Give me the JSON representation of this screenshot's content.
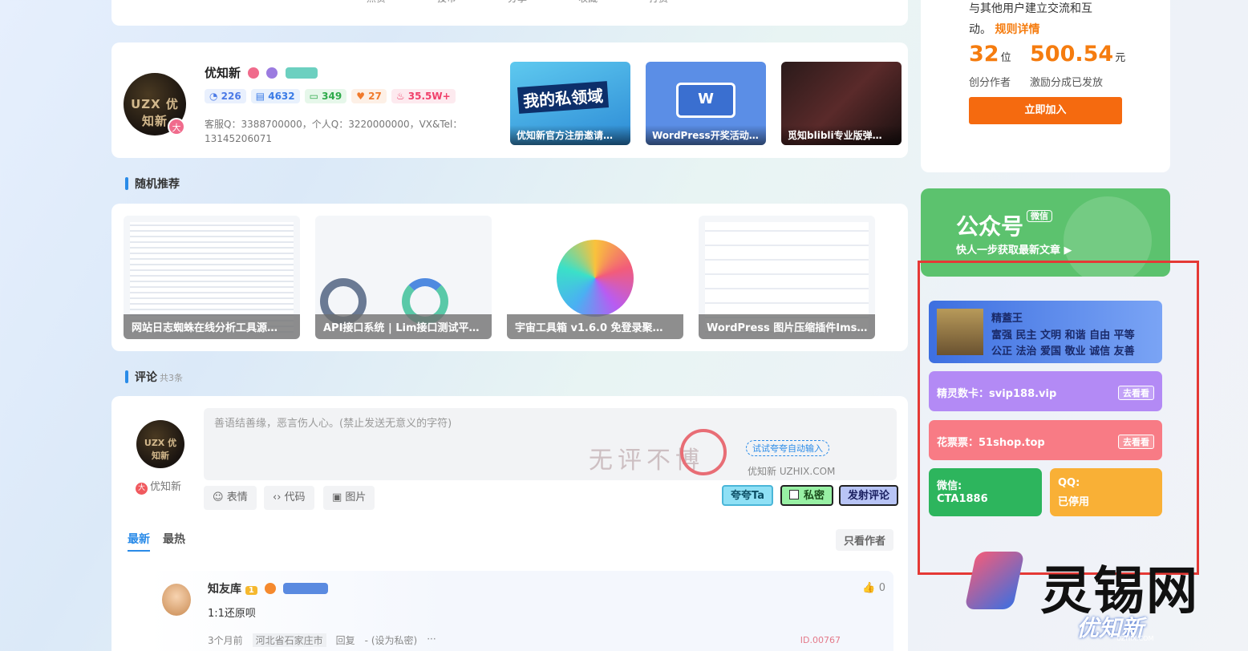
{
  "top_nav": [
    "点赞",
    "投币",
    "分享",
    "收藏",
    "打赏"
  ],
  "author": {
    "name": "优知新",
    "logo_text": "UZX 优知新",
    "level_badge": "大",
    "stats": [
      {
        "icon": "chat-icon",
        "value": "226",
        "color": "#4a79e6",
        "bg": "#e9f0fd"
      },
      {
        "icon": "doc-icon",
        "value": "4632",
        "color": "#3a7be6",
        "bg": "#e8f1fd"
      },
      {
        "icon": "message-icon",
        "value": "349",
        "color": "#2eaa4a",
        "bg": "#e6f7ea"
      },
      {
        "icon": "heart-icon",
        "value": "27",
        "color": "#f07a2c",
        "bg": "#fdf0e6"
      },
      {
        "icon": "fire-icon",
        "value": "35.5W+",
        "color": "#f0406a",
        "bg": "#fdeaef"
      }
    ],
    "description": "客服Q：3388700000，个人Q：3220000000，VX&Tel：13145206071",
    "posts": [
      {
        "title": "优知新官方注册邀请…",
        "headline": "我的私领域"
      },
      {
        "title": "WordPress开奖活动…",
        "headline": "W"
      },
      {
        "title": "觅知blibli专业版弹…",
        "headline": ""
      }
    ]
  },
  "random": {
    "title": "随机推荐",
    "items": [
      {
        "title": "网站日志蜘蛛在线分析工具源…"
      },
      {
        "title": "API接口系统 | Lim接口测试平…"
      },
      {
        "title": "宇宙工具箱 v1.6.0 免登录聚…"
      },
      {
        "title": "WordPress 图片压缩插件Ims…"
      }
    ]
  },
  "comments": {
    "title": "评论",
    "count": "共3条",
    "user": "优知新",
    "user_badge": "大",
    "placeholder": "善语结善缘，恶言伤人心。(禁止发送无意义的字符)",
    "bubble": "试试夸夸自动输入",
    "site": "优知新 UZHIX.COM",
    "stamp": "无评不博",
    "tools": [
      "表情",
      "代码",
      "图片"
    ],
    "actions": {
      "praise": "夸夸Ta",
      "private": "私密",
      "submit": "发射评论"
    },
    "tabs": [
      "最新",
      "最热"
    ],
    "only_author": "只看作者",
    "item": {
      "user": "知友库",
      "level": "1",
      "text": "1:1还原呗",
      "time": "3个月前",
      "location": "河北省石家庄市",
      "reply": "回复",
      "private": "- (设为私密)",
      "more": "···",
      "likes": "0",
      "id": "ID.00767"
    }
  },
  "sidebar": {
    "intro_line": "与其他用户建立交流和互",
    "intro_line2": "动。",
    "rules_link": "规则详情",
    "authors_count": "32",
    "authors_unit": "位",
    "authors_label": "创分作者",
    "reward": "500.54",
    "reward_unit": "元",
    "reward_label": "激励分成已发放",
    "join_btn": "立即加入",
    "wechat_title": "公众号",
    "wechat_tag": "微信",
    "wechat_sub": "快人一步获取最新文章 ▶",
    "vip": {
      "name": "精蓋王",
      "line1": "富强 民主 文明 和谐 自由 平等",
      "line2": "公正 法治 爱国 敬业 诚信 友善"
    },
    "links": [
      {
        "label": "精灵数卡：svip188.vip",
        "btn": "去看看",
        "color": "#b38af5"
      },
      {
        "label": "花票票：51shop.top",
        "btn": "去看看",
        "color": "#f87b85"
      }
    ],
    "wechat_contact": {
      "label": "微信:",
      "value": "CTA1886",
      "color": "#2db55d"
    },
    "qq_contact": {
      "label": "QQ:",
      "value": "已停用",
      "color": "#f9b036"
    }
  },
  "watermark": {
    "brand": "灵锡网",
    "logo": "优知新",
    "url": "UZHIX.COM"
  }
}
